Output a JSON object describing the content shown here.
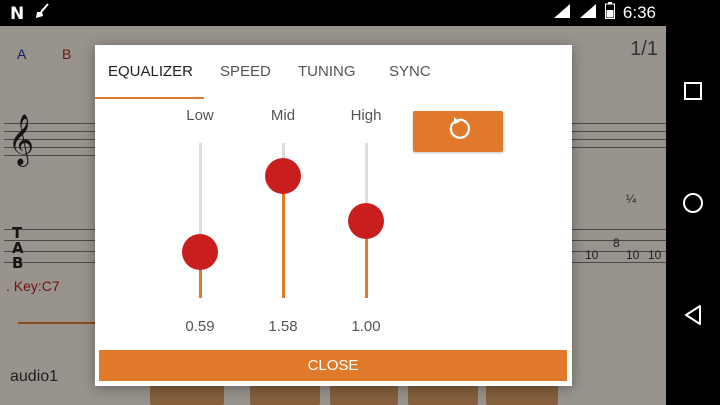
{
  "status_bar": {
    "time": "6:36",
    "left_icons": [
      "n-notification-icon",
      "broom-icon"
    ],
    "right_icons": [
      "wifi-icon",
      "signal-icon",
      "battery-icon"
    ]
  },
  "background": {
    "track_a": "A",
    "track_b": "B",
    "page_number": "1/1",
    "key_label": ". Key:C7",
    "audio_label": "audio1",
    "tab_numbers": [
      "10",
      "8",
      "10",
      "10"
    ],
    "fraction_label": "¼"
  },
  "equalizer_dialog": {
    "tabs": [
      {
        "label": "EQUALIZER",
        "active": true
      },
      {
        "label": "SPEED",
        "active": false
      },
      {
        "label": "TUNING",
        "active": false
      },
      {
        "label": "SYNC",
        "active": false
      }
    ],
    "bands": [
      {
        "label": "Low",
        "value_text": "0.59",
        "level": 0.3
      },
      {
        "label": "Mid",
        "value_text": "1.58",
        "level": 0.79
      },
      {
        "label": "High",
        "value_text": "1.00",
        "level": 0.5
      }
    ],
    "reset_icon": "reset-rotate-icon",
    "close_label": "CLOSE"
  },
  "colors": {
    "accent": "#e07a2a",
    "thumb": "#c91e1e"
  }
}
